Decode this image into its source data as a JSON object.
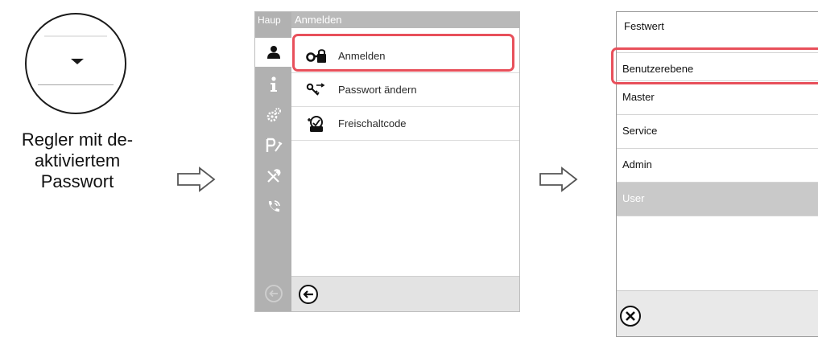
{
  "caption": {
    "line1": "Regler mit de-",
    "line2": "aktiviertem",
    "line3": "Passwort"
  },
  "controller_icon": "password-disabled-circle",
  "screen1": {
    "sidebar_title": "Haup",
    "header": "Anmelden",
    "sidebar_icons": [
      "user-icon",
      "info-icon",
      "settings-gears-icon",
      "program-icon",
      "tools-icon",
      "service-phone-icon",
      "back-icon"
    ],
    "items": [
      {
        "label": "Anmelden",
        "icon": "login-key-icon"
      },
      {
        "label": "Passwort ändern",
        "icon": "change-password-icon"
      },
      {
        "label": "Freischaltcode",
        "icon": "unlock-code-icon"
      }
    ],
    "footer_icon": "back-icon"
  },
  "screen2": {
    "title": "Festwert",
    "options": [
      "Benutzerebene",
      "Master",
      "Service",
      "Admin",
      "User"
    ],
    "selected": "User",
    "footer_icon": "cancel-icon"
  },
  "colors": {
    "highlight": "#e8505b",
    "sidebar": "#b1b1b1",
    "selected_row": "#c9c9c9"
  }
}
